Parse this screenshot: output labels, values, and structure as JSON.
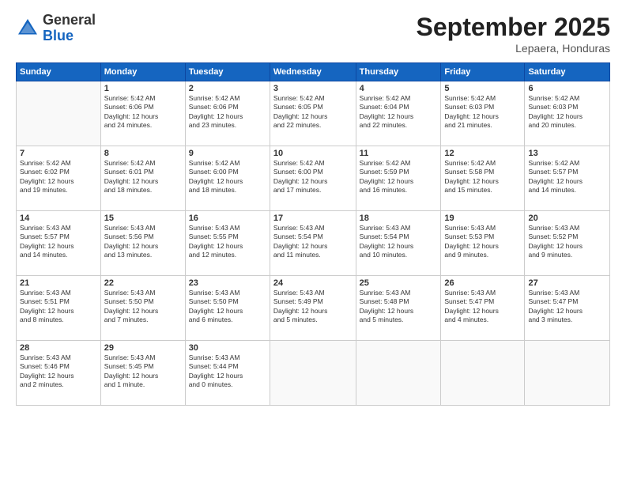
{
  "header": {
    "logo": {
      "general": "General",
      "blue": "Blue"
    },
    "title": "September 2025",
    "location": "Lepaera, Honduras"
  },
  "days": [
    "Sunday",
    "Monday",
    "Tuesday",
    "Wednesday",
    "Thursday",
    "Friday",
    "Saturday"
  ],
  "weeks": [
    [
      {
        "num": "",
        "info": ""
      },
      {
        "num": "1",
        "info": "Sunrise: 5:42 AM\nSunset: 6:06 PM\nDaylight: 12 hours\nand 24 minutes."
      },
      {
        "num": "2",
        "info": "Sunrise: 5:42 AM\nSunset: 6:06 PM\nDaylight: 12 hours\nand 23 minutes."
      },
      {
        "num": "3",
        "info": "Sunrise: 5:42 AM\nSunset: 6:05 PM\nDaylight: 12 hours\nand 22 minutes."
      },
      {
        "num": "4",
        "info": "Sunrise: 5:42 AM\nSunset: 6:04 PM\nDaylight: 12 hours\nand 22 minutes."
      },
      {
        "num": "5",
        "info": "Sunrise: 5:42 AM\nSunset: 6:03 PM\nDaylight: 12 hours\nand 21 minutes."
      },
      {
        "num": "6",
        "info": "Sunrise: 5:42 AM\nSunset: 6:03 PM\nDaylight: 12 hours\nand 20 minutes."
      }
    ],
    [
      {
        "num": "7",
        "info": "Sunrise: 5:42 AM\nSunset: 6:02 PM\nDaylight: 12 hours\nand 19 minutes."
      },
      {
        "num": "8",
        "info": "Sunrise: 5:42 AM\nSunset: 6:01 PM\nDaylight: 12 hours\nand 18 minutes."
      },
      {
        "num": "9",
        "info": "Sunrise: 5:42 AM\nSunset: 6:00 PM\nDaylight: 12 hours\nand 18 minutes."
      },
      {
        "num": "10",
        "info": "Sunrise: 5:42 AM\nSunset: 6:00 PM\nDaylight: 12 hours\nand 17 minutes."
      },
      {
        "num": "11",
        "info": "Sunrise: 5:42 AM\nSunset: 5:59 PM\nDaylight: 12 hours\nand 16 minutes."
      },
      {
        "num": "12",
        "info": "Sunrise: 5:42 AM\nSunset: 5:58 PM\nDaylight: 12 hours\nand 15 minutes."
      },
      {
        "num": "13",
        "info": "Sunrise: 5:42 AM\nSunset: 5:57 PM\nDaylight: 12 hours\nand 14 minutes."
      }
    ],
    [
      {
        "num": "14",
        "info": "Sunrise: 5:43 AM\nSunset: 5:57 PM\nDaylight: 12 hours\nand 14 minutes."
      },
      {
        "num": "15",
        "info": "Sunrise: 5:43 AM\nSunset: 5:56 PM\nDaylight: 12 hours\nand 13 minutes."
      },
      {
        "num": "16",
        "info": "Sunrise: 5:43 AM\nSunset: 5:55 PM\nDaylight: 12 hours\nand 12 minutes."
      },
      {
        "num": "17",
        "info": "Sunrise: 5:43 AM\nSunset: 5:54 PM\nDaylight: 12 hours\nand 11 minutes."
      },
      {
        "num": "18",
        "info": "Sunrise: 5:43 AM\nSunset: 5:54 PM\nDaylight: 12 hours\nand 10 minutes."
      },
      {
        "num": "19",
        "info": "Sunrise: 5:43 AM\nSunset: 5:53 PM\nDaylight: 12 hours\nand 9 minutes."
      },
      {
        "num": "20",
        "info": "Sunrise: 5:43 AM\nSunset: 5:52 PM\nDaylight: 12 hours\nand 9 minutes."
      }
    ],
    [
      {
        "num": "21",
        "info": "Sunrise: 5:43 AM\nSunset: 5:51 PM\nDaylight: 12 hours\nand 8 minutes."
      },
      {
        "num": "22",
        "info": "Sunrise: 5:43 AM\nSunset: 5:50 PM\nDaylight: 12 hours\nand 7 minutes."
      },
      {
        "num": "23",
        "info": "Sunrise: 5:43 AM\nSunset: 5:50 PM\nDaylight: 12 hours\nand 6 minutes."
      },
      {
        "num": "24",
        "info": "Sunrise: 5:43 AM\nSunset: 5:49 PM\nDaylight: 12 hours\nand 5 minutes."
      },
      {
        "num": "25",
        "info": "Sunrise: 5:43 AM\nSunset: 5:48 PM\nDaylight: 12 hours\nand 5 minutes."
      },
      {
        "num": "26",
        "info": "Sunrise: 5:43 AM\nSunset: 5:47 PM\nDaylight: 12 hours\nand 4 minutes."
      },
      {
        "num": "27",
        "info": "Sunrise: 5:43 AM\nSunset: 5:47 PM\nDaylight: 12 hours\nand 3 minutes."
      }
    ],
    [
      {
        "num": "28",
        "info": "Sunrise: 5:43 AM\nSunset: 5:46 PM\nDaylight: 12 hours\nand 2 minutes."
      },
      {
        "num": "29",
        "info": "Sunrise: 5:43 AM\nSunset: 5:45 PM\nDaylight: 12 hours\nand 1 minute."
      },
      {
        "num": "30",
        "info": "Sunrise: 5:43 AM\nSunset: 5:44 PM\nDaylight: 12 hours\nand 0 minutes."
      },
      {
        "num": "",
        "info": ""
      },
      {
        "num": "",
        "info": ""
      },
      {
        "num": "",
        "info": ""
      },
      {
        "num": "",
        "info": ""
      }
    ]
  ]
}
